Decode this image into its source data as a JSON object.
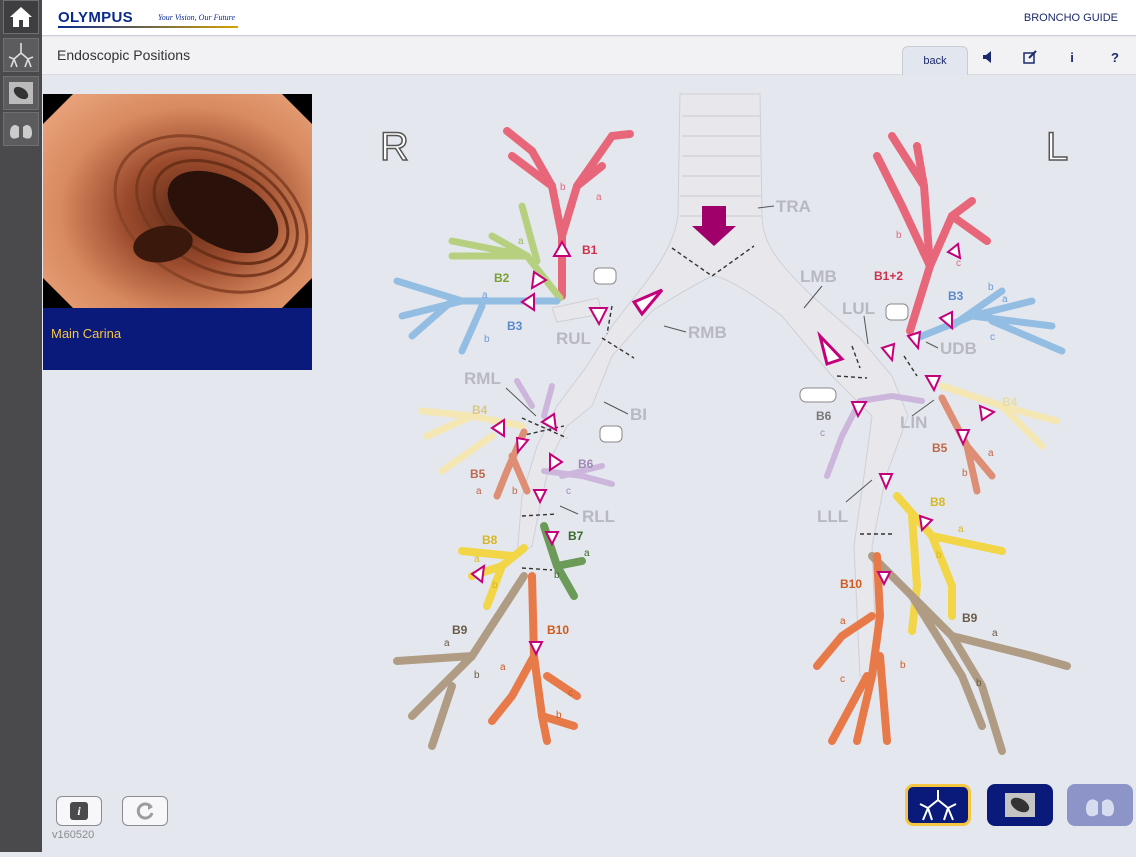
{
  "header": {
    "brand": "OLYMPUS",
    "tagline": "Your Vision, Our Future",
    "app_title": "BRONCHO GUIDE"
  },
  "subheader": {
    "title": "Endoscopic Positions",
    "back_label": "back",
    "help_label": "?",
    "info_label": "i"
  },
  "left_nav": {
    "items": [
      "home-icon",
      "bronchial-tree-icon",
      "endoscope-view-icon",
      "lungs-icon"
    ]
  },
  "video": {
    "caption": "Main Carina"
  },
  "diagram": {
    "side_right": "R",
    "side_left": "L",
    "labels": {
      "tra": "TRA",
      "rmb": "RMB",
      "lmb": "LMB",
      "rul": "RUL",
      "bi": "BI",
      "rml": "RML",
      "rll": "RLL",
      "lul": "LUL",
      "udb": "UDB",
      "lin": "LIN",
      "lll": "LLL",
      "rb1": "B1",
      "rb2": "B2",
      "rb3": "B3",
      "rb4": "B4",
      "rb5": "B5",
      "rb6": "B6",
      "rb7": "B7",
      "rb8": "B8",
      "rb9": "B9",
      "rb10": "B10",
      "lb12": "B1+2",
      "lb3": "B3",
      "lb4": "B4",
      "lb5": "B5",
      "lb6": "B6",
      "lb8": "B8",
      "lb9": "B9",
      "lb10": "B10",
      "sub_a": "a",
      "sub_b": "b",
      "sub_c": "c"
    },
    "colors": {
      "b1": "#e04a5c",
      "b2": "#a6c86a",
      "b3": "#8ab4e0",
      "b4": "#f3e4a8",
      "b5": "#d8846a",
      "b6": "#c9b0d8",
      "b7": "#5c8a4a",
      "b8": "#f0d040",
      "b9": "#a89078",
      "b10": "#e06a3a",
      "airway": "#e6e6ea",
      "arrow": "#b8006a"
    }
  },
  "footer": {
    "version": "v160520",
    "info_button": "i"
  },
  "bottom_nav": {
    "items": [
      "tree-view",
      "endoscope-view",
      "lung-view"
    ]
  }
}
